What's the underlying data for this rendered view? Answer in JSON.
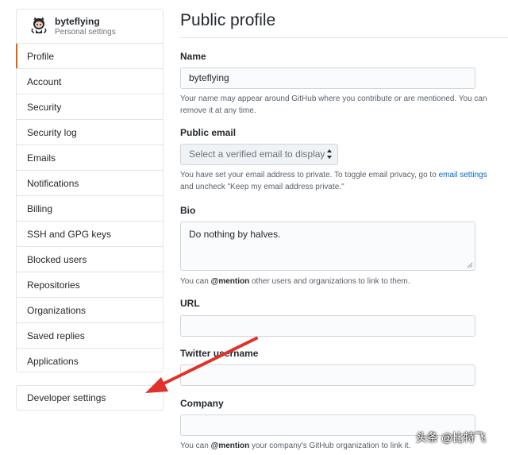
{
  "user": {
    "name": "byteflying",
    "subtitle": "Personal settings"
  },
  "sidebar": {
    "items": [
      {
        "label": "Profile",
        "selected": true
      },
      {
        "label": "Account"
      },
      {
        "label": "Security"
      },
      {
        "label": "Security log"
      },
      {
        "label": "Emails"
      },
      {
        "label": "Notifications"
      },
      {
        "label": "Billing"
      },
      {
        "label": "SSH and GPG keys"
      },
      {
        "label": "Blocked users"
      },
      {
        "label": "Repositories"
      },
      {
        "label": "Organizations"
      },
      {
        "label": "Saved replies"
      },
      {
        "label": "Applications"
      }
    ],
    "developer_settings": "Developer settings",
    "accent_color": "#e36209"
  },
  "main": {
    "title": "Public profile",
    "name": {
      "label": "Name",
      "value": "byteflying",
      "note": "Your name may appear around GitHub where you contribute or are mentioned. You can remove it at any time."
    },
    "public_email": {
      "label": "Public email",
      "selected": "Select a verified email to display",
      "note_before": "You have set your email address to private. To toggle email privacy, go to ",
      "note_link": "email settings",
      "note_after": "and uncheck \"Keep my email address private.\""
    },
    "bio": {
      "label": "Bio",
      "value": "Do nothing by halves.",
      "note_before": "You can ",
      "note_mention": "@mention",
      "note_after": " other users and organizations to link to them."
    },
    "url": {
      "label": "URL",
      "value": ""
    },
    "twitter": {
      "label": "Twitter username",
      "value": ""
    },
    "company": {
      "label": "Company",
      "value": "",
      "note_before": "You can ",
      "note_mention": "@mention",
      "note_after": " your company's GitHub organization to link it."
    }
  },
  "watermark": "头条 @比特飞",
  "colors": {
    "link": "#0366d6",
    "annotation_arrow": "#e0322b"
  }
}
